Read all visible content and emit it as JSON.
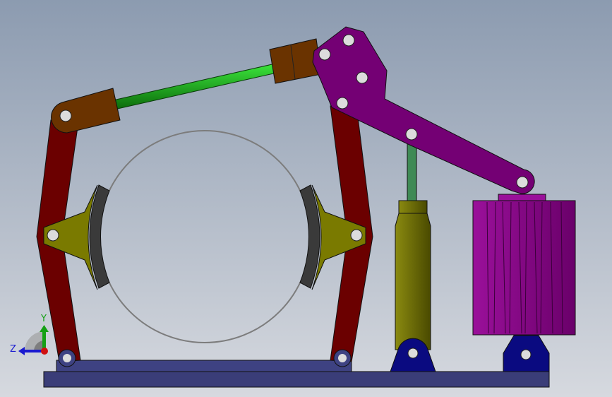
{
  "viewport": {
    "triad": {
      "y_label": "Y",
      "z_label": "Z"
    },
    "colors": {
      "brake_arm": "#6b0000",
      "shoe": "#7a7a00",
      "lining": "#3a3a3a",
      "link_block": "#6a3300",
      "rod": "#1aa81a",
      "lever": "#740074",
      "thruster": "#6f6f00",
      "motor": "#8a008a",
      "base": "#3a3d78",
      "mount": "#0a0a80"
    }
  }
}
